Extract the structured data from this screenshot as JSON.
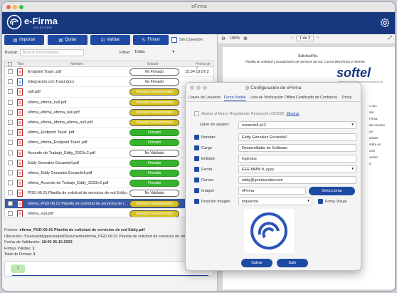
{
  "window": {
    "title": "eFirma"
  },
  "header": {
    "logo_text": "e-Firma",
    "logo_sub": "ESCRITORIO"
  },
  "toolbar": {
    "import_label": "Importar",
    "remove_label": "Quitar",
    "validate_label": "Validar",
    "sign_label": "Firmar",
    "offline_label": "Sin Conexión"
  },
  "search": {
    "label": "Buscar:",
    "placeholder": "Buscar Documentos...",
    "filter_label": "Filtrar:",
    "filter_value": "Todos"
  },
  "table": {
    "headers": {
      "type": "Tipo",
      "name": "Nombre",
      "state": "Estado",
      "date": "Fecha de V"
    },
    "rows": [
      {
        "icon": "pdf",
        "name": "Endpoint Toast .pdf",
        "state": "No Firmado",
        "kind": "nofirm",
        "date": "15.34 19.07.2"
      },
      {
        "icon": "docx",
        "name": "Integracion con Toast.docx",
        "state": "No Firmado",
        "kind": "nofirm",
        "date": ""
      },
      {
        "icon": "pdf",
        "name": "null.pdf",
        "state": "Firmado Indeterminado",
        "kind": "indet",
        "date": ""
      },
      {
        "icon": "pdf",
        "name": "efirma_efirma_null.pdf",
        "state": "Firmado Indeterminado",
        "kind": "indet",
        "date": ""
      },
      {
        "icon": "pdf",
        "name": "efirma_efirma_efirma_null.pdf",
        "state": "Firmado Indeterminado",
        "kind": "indet",
        "date": ""
      },
      {
        "icon": "pdf",
        "name": "efirma_efirma_efirma_efirma_null.pdf",
        "state": "Firmado Indeterminado",
        "kind": "indet",
        "date": ""
      },
      {
        "icon": "pdf",
        "name": "efirma_Endpoint Toast .pdf",
        "state": "Firmado",
        "kind": "firm",
        "date": ""
      },
      {
        "icon": "pdf",
        "name": "efirma_efirma_Endpoint Toast .pdf",
        "state": "Firmado",
        "kind": "firm",
        "date": ""
      },
      {
        "icon": "pdf",
        "name": "Acuerdo de Trabajo_Eddy_2023v.2.pdf",
        "state": "No Validado",
        "kind": "noval",
        "date": ""
      },
      {
        "icon": "pdf",
        "name": "Eddy Gonzalez Escandell.pdf",
        "state": "Firmado",
        "kind": "firm",
        "date": ""
      },
      {
        "icon": "pdf",
        "name": "efirma_Eddy Gonzalez Escandell.pdf",
        "state": "Firmado",
        "kind": "firm",
        "date": ""
      },
      {
        "icon": "pdf",
        "name": "efirma_Acuerdo de Trabajo_Eddy_2023v.2.pdf",
        "state": "Firmado",
        "kind": "firm",
        "date": ""
      },
      {
        "icon": "pdf",
        "name": "PGD-06.01 Planilla de solicitud de servicios de red Eddy.pdf",
        "state": "No Validado",
        "kind": "noval",
        "date": ""
      },
      {
        "icon": "pdf",
        "name": "efirma_PGD-06.01 Planilla de solicitud de servicios de r...",
        "state": "Firmado Indeterminado",
        "kind": "indet",
        "date": "",
        "selected": true
      },
      {
        "icon": "pdf",
        "name": "efirma_null.pdf",
        "state": "Firmado Indeterminado",
        "kind": "indet",
        "date": ""
      }
    ]
  },
  "info": {
    "file_label": "Fichero:",
    "file_value": "efirma_PGD-06.01 Planilla de solicitud de servicios de red Eddy.pdf",
    "location_label": "Ubicación:",
    "location_value": "/Users/eddygescandell/Documents/efirma_PGD-06.01 Planilla de solicitud de servicios de red Edd",
    "validation_label": "Fecha de Validación:",
    "validation_value": "18:06 26.10.2023",
    "valid_label": "Firmas Válidas:",
    "valid_value": "1",
    "total_label": "Total de Firmas:",
    "total_value": "1",
    "tag": "1"
  },
  "viewer": {
    "zoom": "100%",
    "page_current": "1",
    "page_sep": "de",
    "page_total": "2",
    "doc_heading": "Solicitud No.",
    "doc_subheading": "Planilla de solicitud y actualización de servicios de red, Correo electrónico e Internet",
    "doc_brand": "softel",
    "doc_brand_sub": "EMPRESA DE PRODUCTOS INFORMÁTICOS",
    "side_texts": [
      "o vez",
      "del",
      "Firma",
      "de Usuario",
      "ue",
      "ariado",
      "mbre es",
      "ción",
      "solver",
      "d"
    ]
  },
  "dialog": {
    "title": "Configuración de eFirma",
    "tabs": [
      "Llaves de Usuarios",
      "Firma Visible",
      "Lista de Verificación Offline",
      "Certificado de Confianza",
      "Proxy"
    ],
    "adjust_label": "Ajustar al Marco Regulatorio: Resolución 23/2022",
    "adjust_link": "Mostrar",
    "user_key_label": "Llave de usuario:",
    "user_key_value": "escandell.p12",
    "fields": [
      {
        "label": "Nombre",
        "value": "Eddy Gonzalez Escandell"
      },
      {
        "label": "Cargo",
        "value": "Desarrollador de Software"
      },
      {
        "label": "Entidad",
        "value": "Ingenius"
      },
      {
        "label": "Fecha",
        "value": "EEE,MMM d, yyyy"
      },
      {
        "label": "Correo",
        "value": "eddy@geniuscuba.com"
      }
    ],
    "image_label": "Imagen",
    "image_value": "eFirma",
    "select_label": "Seleccionar",
    "position_label": "Posición Imagen",
    "position_value": "Izquierda",
    "visible_label": "Firma Visual",
    "save_label": "Salvar",
    "exit_label": "Salir"
  },
  "colors": {
    "brand": "#17387f",
    "button": "#1f4aa3",
    "signed": "#36b42c",
    "indeterminate": "#d7c21b"
  }
}
